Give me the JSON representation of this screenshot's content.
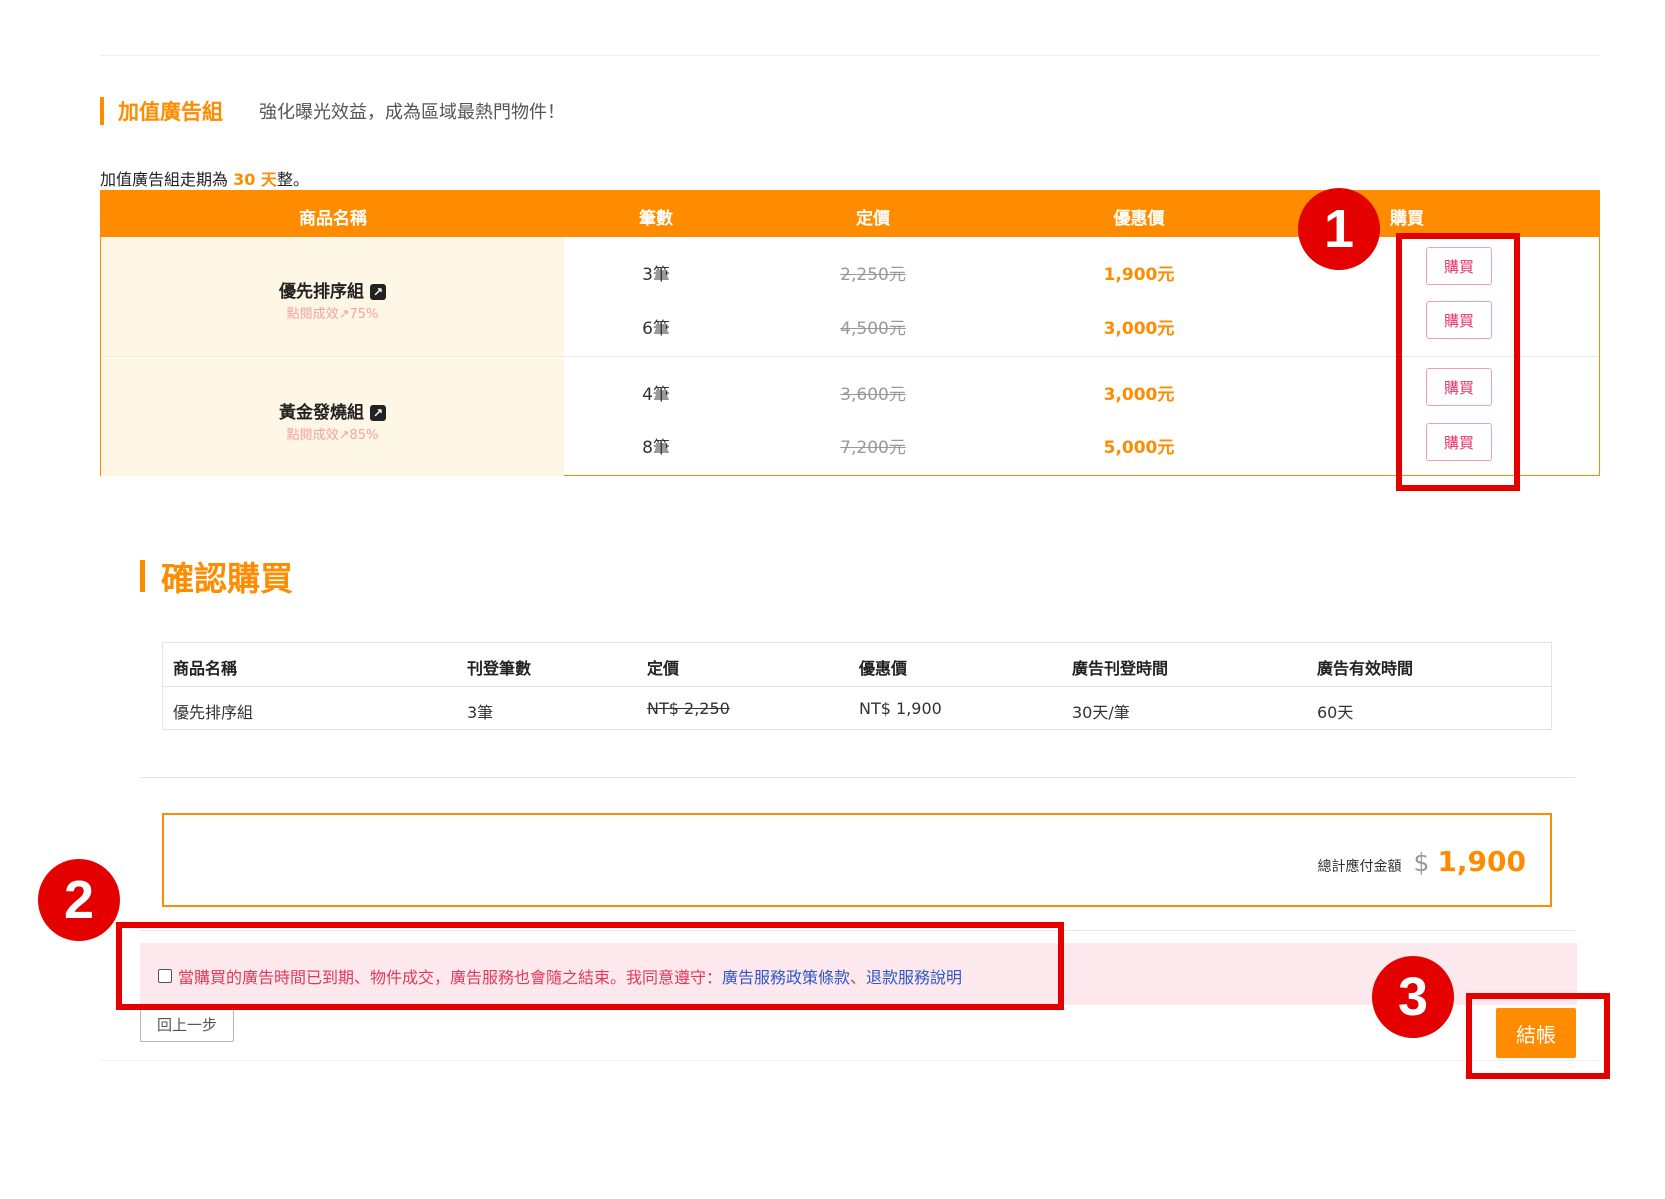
{
  "addon": {
    "title": "加值廣告組",
    "subtitle": "強化曝光效益，成為區域最熱門物件！",
    "period_prefix": "加值廣告組走期為 ",
    "period_days": "30 天",
    "period_suffix": "整。"
  },
  "package_table": {
    "headers": [
      "商品名稱",
      "筆數",
      "定價",
      "優惠價",
      "購買"
    ],
    "groups": [
      {
        "name": "優先排序組",
        "effect": "點閱成效↗75%",
        "rows": [
          {
            "count": "3筆",
            "original": "2,250元",
            "sale": "1,900元",
            "buy": "購買"
          },
          {
            "count": "6筆",
            "original": "4,500元",
            "sale": "3,000元",
            "buy": "購買"
          }
        ]
      },
      {
        "name": "黃金發燒組",
        "effect": "點閱成效↗85%",
        "rows": [
          {
            "count": "4筆",
            "original": "3,600元",
            "sale": "3,000元",
            "buy": "購買"
          },
          {
            "count": "8筆",
            "original": "7,200元",
            "sale": "5,000元",
            "buy": "購買"
          }
        ]
      }
    ]
  },
  "confirm": {
    "title": "確認購買",
    "headers": [
      "商品名稱",
      "刊登筆數",
      "定價",
      "優惠價",
      "廣告刊登時間",
      "廣告有效時間"
    ],
    "row": [
      "優先排序組",
      "3筆",
      "NT$ 2,250",
      "NT$ 1,900",
      "30天/筆",
      "60天"
    ]
  },
  "total": {
    "label": "總計應付金額",
    "currency": "$",
    "amount": "1,900"
  },
  "agreement": {
    "text": "當購買的廣告時間已到期、物件成交，廣告服務也會隨之結束。我同意遵守：",
    "link1": "廣告服務政策條款",
    "separator": "、",
    "link2": "退款服務說明"
  },
  "actions": {
    "back": "回上一步",
    "checkout": "結帳"
  },
  "annotations": {
    "markers": [
      "1",
      "2",
      "3"
    ],
    "color": "#e50000"
  },
  "colors": {
    "accent": "#ff8c00",
    "package_name_bg": "#fff7e6",
    "buy_text": "#e8336b",
    "agree_bg": "#fde8ee",
    "link": "#3057c7"
  },
  "icons": {
    "external_link": "external-link-icon"
  }
}
